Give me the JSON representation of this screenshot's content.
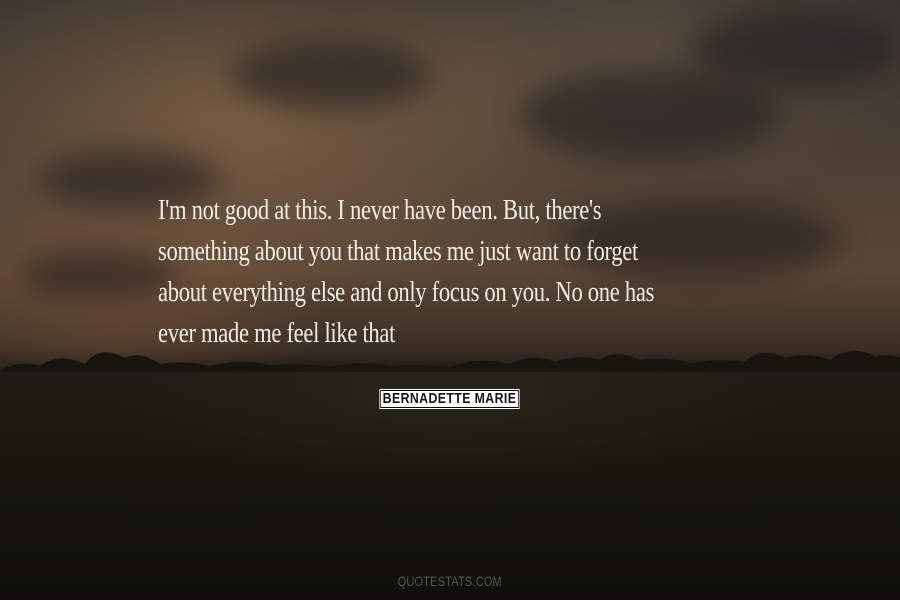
{
  "quote": {
    "lines": [
      "I'm not good at this. I never have been. But, there's",
      "something about you that makes me just want to forget",
      "about everything else and only focus on you. No one has",
      "ever made me feel like that"
    ]
  },
  "author": {
    "name": "BERNADETTE MARIE"
  },
  "watermark": {
    "text": "QUOTESTATS.COM"
  },
  "colors": {
    "quote_text": "#f2efe9",
    "author_bg": "#ffffff",
    "author_text": "#141414"
  }
}
